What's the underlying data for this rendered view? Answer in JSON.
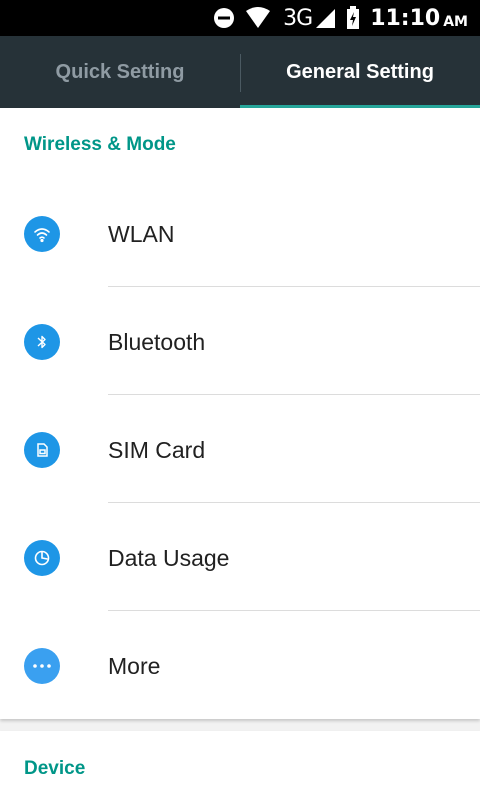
{
  "status_bar": {
    "network": "3G",
    "time": "11:10",
    "ampm": "AM",
    "icons": [
      "do-not-disturb-icon",
      "wifi-icon",
      "signal-icon",
      "battery-charging-icon"
    ]
  },
  "tabs": [
    {
      "label": "Quick Setting",
      "active": false
    },
    {
      "label": "General Setting",
      "active": true
    }
  ],
  "sections": {
    "wireless": {
      "title": "Wireless & Mode",
      "items": [
        {
          "label": "WLAN",
          "icon": "wifi-icon"
        },
        {
          "label": "Bluetooth",
          "icon": "bluetooth-icon"
        },
        {
          "label": "SIM Card",
          "icon": "sim-card-icon"
        },
        {
          "label": "Data Usage",
          "icon": "data-usage-icon"
        },
        {
          "label": "More",
          "icon": "more-icon"
        }
      ]
    },
    "device": {
      "title": "Device"
    }
  },
  "colors": {
    "accent": "#009688",
    "tab_bg": "#263238",
    "icon_bg": "#1e96e6"
  }
}
